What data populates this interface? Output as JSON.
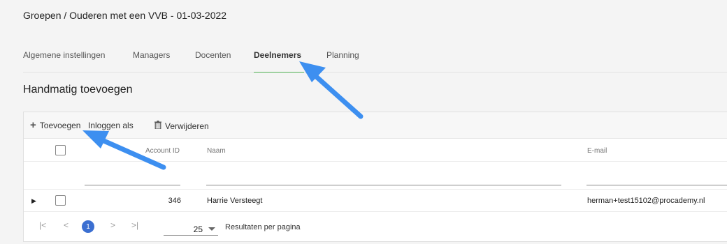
{
  "breadcrumb": "Groepen / Ouderen met een VVB - 01-03-2022",
  "tabs": [
    {
      "label": "Algemene instellingen",
      "active": false
    },
    {
      "label": "Managers",
      "active": false
    },
    {
      "label": "Docenten",
      "active": false
    },
    {
      "label": "Deelnemers",
      "active": true
    },
    {
      "label": "Planning",
      "active": false
    }
  ],
  "section_title": "Handmatig toevoegen",
  "toolbar": {
    "add_label": "Toevoegen",
    "login_as_label": "Inloggen als",
    "delete_label": "Verwijderen",
    "add_icon": "plus-icon",
    "delete_icon": "trash-icon"
  },
  "table": {
    "columns": [
      "Account ID",
      "Naam",
      "E-mail"
    ],
    "rows": [
      {
        "account_id": "346",
        "name": "Harrie Versteegt",
        "email": "herman+test15102@procademy.nl"
      }
    ]
  },
  "pager": {
    "first": "|<",
    "prev": "<",
    "current_page": "1",
    "next": ">",
    "last": ">|",
    "per_page": "25",
    "per_page_label": "Resultaten per pagina"
  },
  "colors": {
    "accent": "#3b6fd1",
    "tab_underline": "#4caf50",
    "annotation_arrow": "#3d8ff0"
  }
}
